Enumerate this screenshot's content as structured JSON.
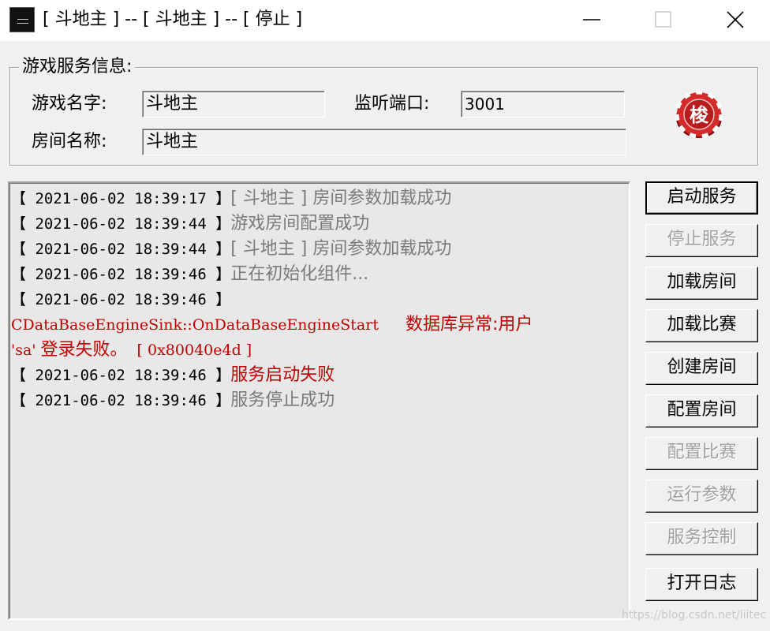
{
  "window": {
    "title": "[ 斗地主 ] -- [ 斗地主 ] -- [ 停止 ]",
    "icon": "game-app-icon"
  },
  "info_group": {
    "title": "游戏服务信息:",
    "game_name_label": "游戏名字:",
    "game_name_value": "斗地主",
    "port_label": "监听端口:",
    "port_value": "3001",
    "room_name_label": "房间名称:",
    "room_name_value": "斗地主",
    "logo_char": "梭",
    "logo_icon": "casino-chip-icon"
  },
  "log": {
    "lines": [
      {
        "time": "【 2021-06-02 18:39:17 】",
        "msg": "[ 斗地主 ] 房间参数加载成功",
        "color": "#7a7a7a"
      },
      {
        "time": "【 2021-06-02 18:39:44 】",
        "msg": "游戏房间配置成功",
        "color": "#7a7a7a"
      },
      {
        "time": "【 2021-06-02 18:39:44 】",
        "msg": "[ 斗地主 ] 房间参数加载成功",
        "color": "#7a7a7a"
      },
      {
        "time": "【 2021-06-02 18:39:46 】",
        "msg": "正在初始化组件...",
        "color": "#7a7a7a"
      },
      {
        "time": "【 2021-06-02 18:39:46 】",
        "msg": "",
        "color": "#7a7a7a"
      },
      {
        "time": "【 2021-06-02 18:39:46 】",
        "msg": "服务启动失败",
        "color": "#c00000"
      },
      {
        "time": "【 2021-06-02 18:39:46 】",
        "msg": "服务停止成功",
        "color": "#7a7a7a"
      }
    ],
    "error_line1_code": "CDataBaseEngineSink::OnDataBaseEngineStart",
    "error_line1_text": "数据库异常:用户",
    "error_line2_q1": "'sa'",
    "error_line2_text": "登录失败。",
    "error_line2_code": "[ 0x80040e4d ]"
  },
  "buttons": {
    "start": "启动服务",
    "stop": "停止服务",
    "load_room": "加载房间",
    "load_match": "加载比赛",
    "create_room": "创建房间",
    "config_room": "配置房间",
    "config_match": "配置比赛",
    "run_params": "运行参数",
    "service_control": "服务控制",
    "open_log": "打开日志"
  },
  "watermark": "https://blog.csdn.net/liitec",
  "colors": {
    "error_red": "#c00000",
    "log_gray": "#7a7a7a",
    "disabled": "#a0a0a0"
  }
}
